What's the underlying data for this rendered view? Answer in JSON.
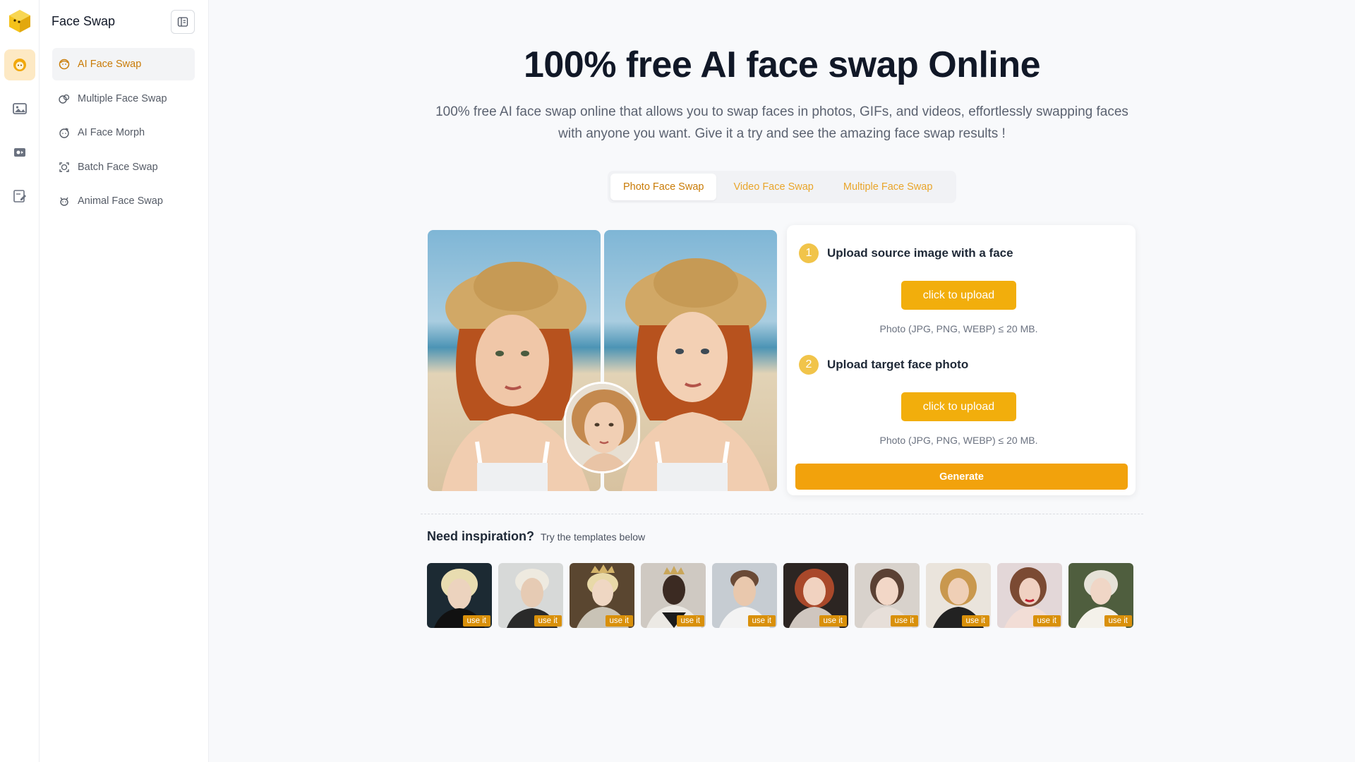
{
  "app": {
    "title": "Face Swap"
  },
  "sidebar": {
    "items": [
      {
        "label": "AI Face Swap",
        "icon": "face-icon",
        "active": true
      },
      {
        "label": "Multiple Face Swap",
        "icon": "multi-face-icon",
        "active": false
      },
      {
        "label": "AI Face Morph",
        "icon": "morph-icon",
        "active": false
      },
      {
        "label": "Batch Face Swap",
        "icon": "batch-icon",
        "active": false
      },
      {
        "label": "Animal Face Swap",
        "icon": "animal-icon",
        "active": false
      }
    ]
  },
  "rail": {
    "icons": [
      "face-swap-icon",
      "image-icon",
      "photo-edit-icon",
      "edit-doc-icon"
    ]
  },
  "hero": {
    "title": "100% free AI face swap Online",
    "subtitle": "100% free AI face swap online that allows you to swap faces in photos, GIFs, and videos, effortlessly swapping faces with anyone you want. Give it a try and see the amazing face swap results !"
  },
  "tabs": [
    {
      "label": "Photo Face Swap",
      "active": true
    },
    {
      "label": "Video Face Swap",
      "active": false
    },
    {
      "label": "Multiple Face Swap",
      "active": false
    }
  ],
  "upload": {
    "step1": {
      "num": "1",
      "label": "Upload source image with a face",
      "button": "click to upload",
      "hint": "Photo (JPG, PNG, WEBP) ≤ 20 MB."
    },
    "step2": {
      "num": "2",
      "label": "Upload target face photo",
      "button": "click to upload",
      "hint": "Photo (JPG, PNG, WEBP) ≤ 20 MB."
    },
    "generate": "Generate"
  },
  "inspiration": {
    "heading": "Need inspiration?",
    "sub": "Try the templates below",
    "use_label": "use it",
    "count": 10
  },
  "colors": {
    "accent": "#f2ae0c",
    "accent_text": "#c97b06",
    "tab_text": "#e9a52a"
  }
}
